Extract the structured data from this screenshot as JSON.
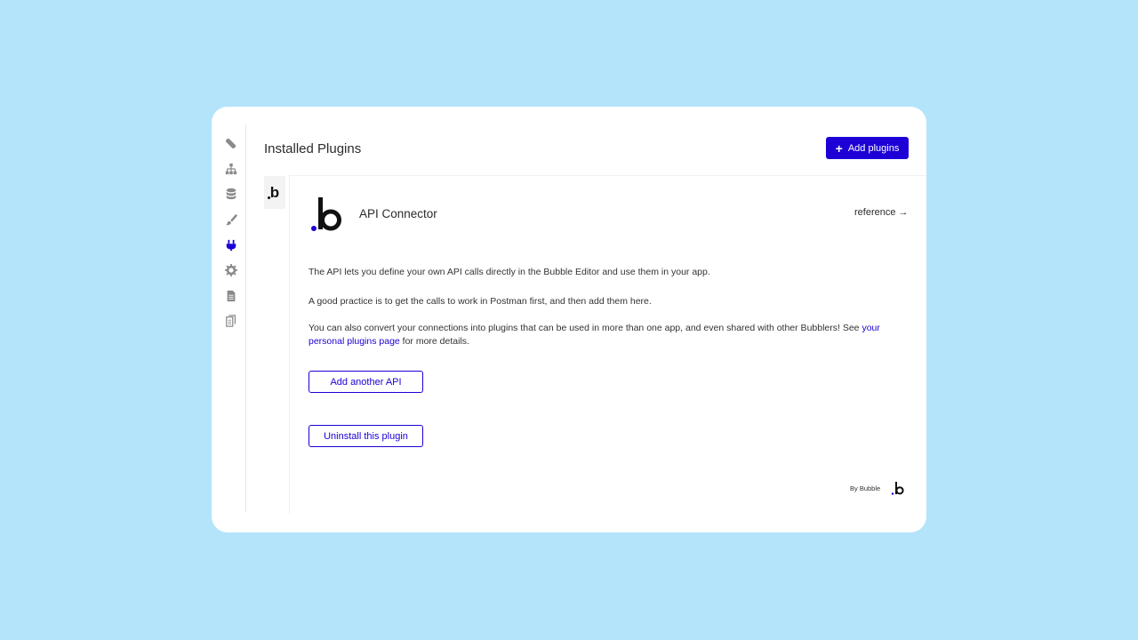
{
  "header": {
    "title": "Installed Plugins",
    "add_button_label": "Add plugins"
  },
  "sidebar": {
    "icons": [
      {
        "name": "design-icon"
      },
      {
        "name": "workflow-icon"
      },
      {
        "name": "data-icon"
      },
      {
        "name": "styles-icon"
      },
      {
        "name": "plugins-icon",
        "active": true
      },
      {
        "name": "settings-icon"
      },
      {
        "name": "logs-icon"
      },
      {
        "name": "copy-icon"
      }
    ]
  },
  "plugin": {
    "tab_logo": "b",
    "name": "API Connector",
    "reference_label": "reference →",
    "description": [
      "The API lets you define your own API calls directly in the Bubble Editor and use them in your app.",
      "A good practice is to get the calls to work in Postman first, and then add them here."
    ],
    "convert_text_before": "You can also convert your connections into plugins that can be used in more than one app, and even shared with other Bubblers! See ",
    "convert_link": "your personal plugins page",
    "convert_text_after": " for more details.",
    "add_another_label": "Add another API",
    "uninstall_label": "Uninstall this plugin",
    "byline": "By Bubble"
  },
  "colors": {
    "accent": "#1c00d6",
    "background": "#b3e4fa"
  }
}
